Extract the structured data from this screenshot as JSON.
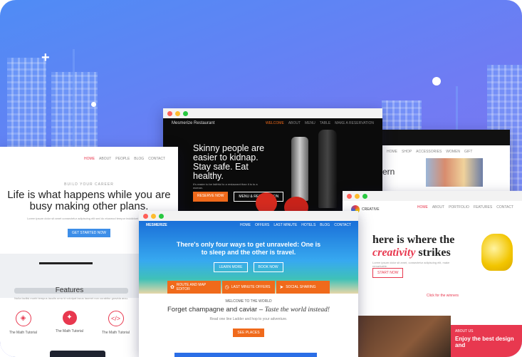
{
  "cards": {
    "restaurant": {
      "brand": "Mesmerize Restaurant",
      "nav": [
        "WELCOME",
        "ABOUT",
        "MENU",
        "TABLE",
        "MAKE A RESERVATION"
      ],
      "headline": "Skinny people are easier to kidnap. Stay safe. Eat healthy.",
      "sub": "It's easier to be faithful to a restaurant than it is to a woman.",
      "btn1": "RESERVE NOW",
      "btn2": "MENU & RESERVATION"
    },
    "career": {
      "kicker": "BUILD YOUR CAREER",
      "headline": "Life is what happens while you are busy making other plans.",
      "sub": "Lorem ipsum dolor sit amet consectetur adipiscing elit sed do eiusmod tempor incididunt ut labore.",
      "button": "GET STARTED NOW",
      "nav": [
        "HOME",
        "ABOUT",
        "PEOPLE",
        "BLOG",
        "CONTACT"
      ],
      "features_title": "Features",
      "features_text": "Nulla facilisi morbi tempus iaculis urna id volutpat lacus laoreet non curabitur gravida arcu.",
      "features": [
        "The Math Tutorial",
        "The Math Tutorial",
        "The Math Tutorial"
      ]
    },
    "travel": {
      "brand": "MESMERIZE",
      "nav": [
        "HOME",
        "OFFERS",
        "LAST MINUTE",
        "HOTELS",
        "BLOG",
        "CONTACT"
      ],
      "headline": "There's only four ways to get unraveled: One is to sleep and the other is travel.",
      "btn1": "LEARN MORE",
      "btn2": "BOOK NOW",
      "features": [
        "ROUTE AND MAP EDITOR",
        "LAST MINUTE OFFERS",
        "SOCIAL SHARING"
      ],
      "welcome": "WELCOME TO THE WORLD",
      "heading": "Forget champagne and caviar –",
      "heading_italic": "Taste the world instead!",
      "sub": "Read one line Ladder and hop to your adventure.",
      "button": "SEE PLACES"
    },
    "creative": {
      "brand": "CREATIVE",
      "nav": [
        "HOME",
        "ABOUT",
        "PORTFOLIO",
        "FEATURES",
        "CONTACT"
      ],
      "headline1": "here is where the",
      "headline_accent": "creativity",
      "headline2": "strikes",
      "sub": "Lorem ipsum dolor sit amet, consectetur adipiscing elit, make remarkable.",
      "button": "START NOW",
      "link": "Click for the winners",
      "promo1": "ABOUT US",
      "promo2": "Enjoy the best design and"
    },
    "shop": {
      "nav": [
        "HOME",
        "SHOP",
        "ACCESSORIES",
        "WOMEN",
        "GIFT"
      ],
      "headline": "ern"
    }
  },
  "colors": {
    "accent_orange": "#f06a1b",
    "accent_red": "#e8384f",
    "accent_blue": "#2b6ee6"
  }
}
